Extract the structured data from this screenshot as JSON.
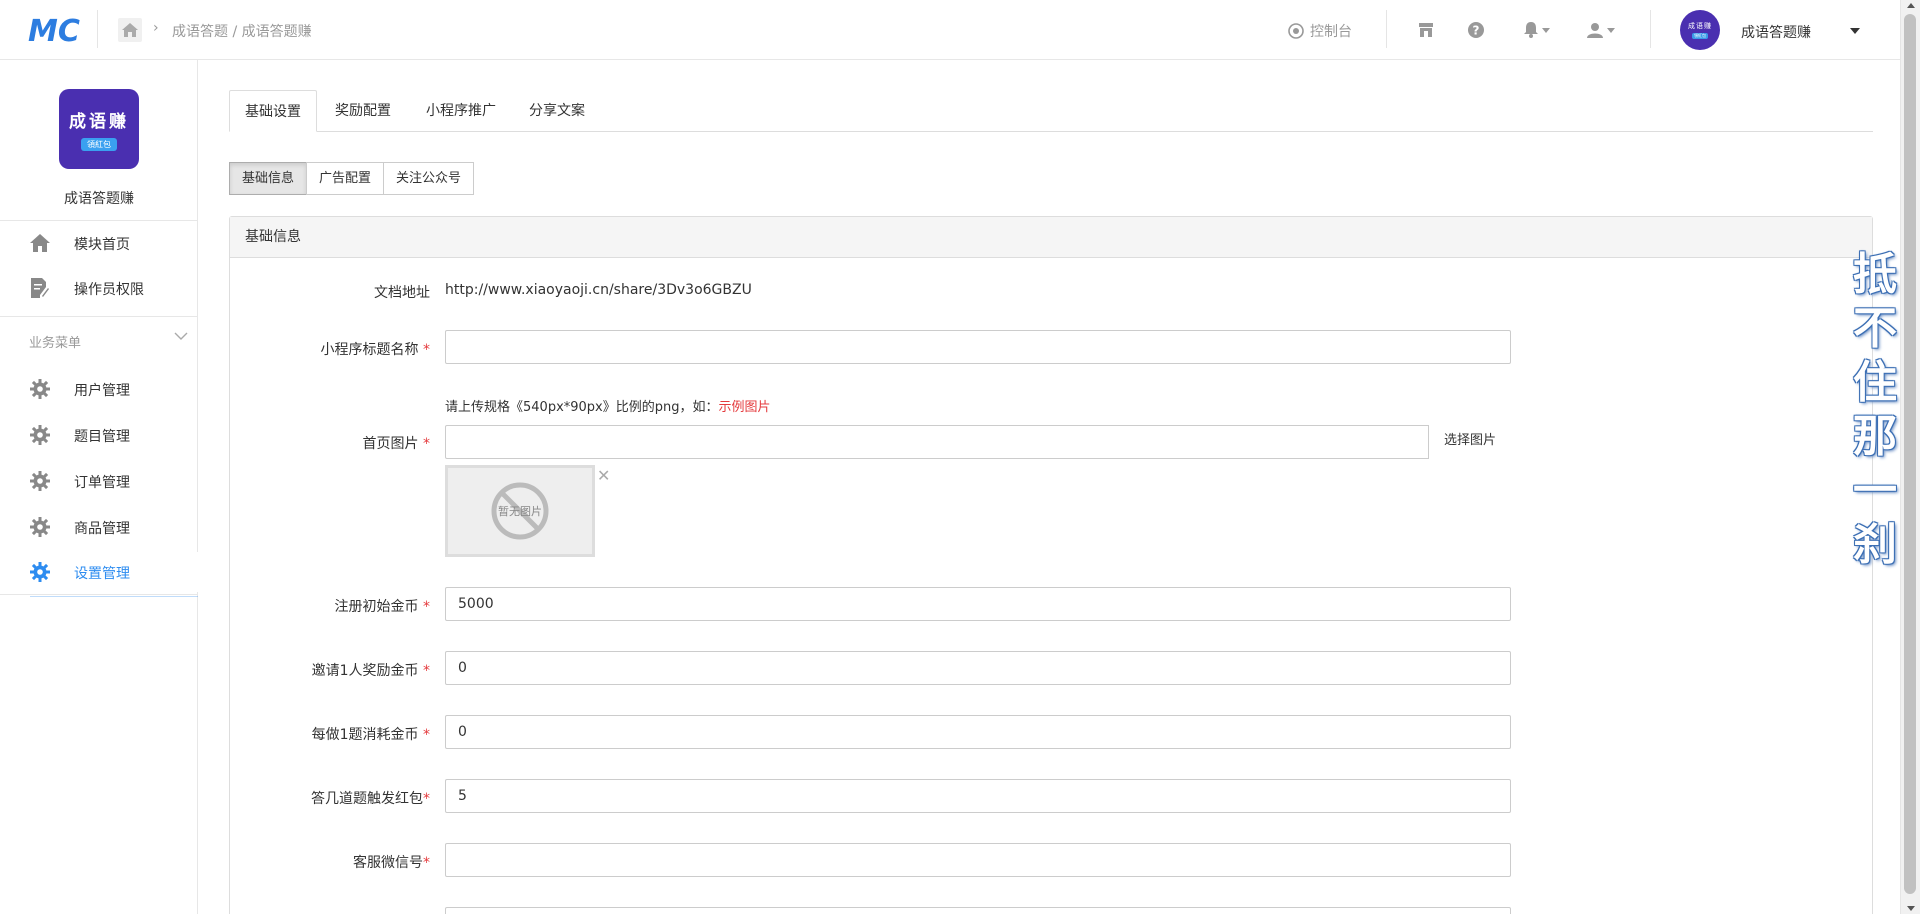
{
  "topbar": {
    "logo_text": "MC",
    "breadcrumb": "成语答题 / 成语答题赚",
    "console_label": "控制台",
    "user_name": "成语答题赚"
  },
  "sidebar": {
    "app_logo_title": "成语赚",
    "app_logo_badge": "領紅包",
    "app_name": "成语答题赚",
    "items_top": [
      {
        "label": "模块首页"
      },
      {
        "label": "操作员权限"
      }
    ],
    "section_title": "业务菜单",
    "items": [
      {
        "label": "用户管理"
      },
      {
        "label": "题目管理"
      },
      {
        "label": "订单管理"
      },
      {
        "label": "商品管理"
      },
      {
        "label": "设置管理"
      }
    ]
  },
  "tabs": [
    "基础设置",
    "奖励配置",
    "小程序推广",
    "分享文案"
  ],
  "subtabs": [
    "基础信息",
    "广告配置",
    "关注公众号"
  ],
  "panel": {
    "title": "基础信息",
    "doc_label": "文档地址",
    "doc_url": "http://www.xiaoyaoji.cn/share/3Dv3o6GBZU",
    "fields": {
      "mini_title_label": "小程序标题名称",
      "home_image_label": "首页图片",
      "home_image_hint": "请上传规格《540px*90px》比例的png，如：",
      "home_image_example": "示例图片",
      "pick_image": "选择图片",
      "no_image": "暂无图片",
      "register_coins_label": "注册初始金币",
      "register_coins_value": "5000",
      "invite_reward_label": "邀请1人奖励金币",
      "invite_reward_value": "0",
      "cost_per_question_label": "每做1题消耗金币",
      "cost_per_question_value": "0",
      "redpack_trigger_label": "答几道题触发红包",
      "redpack_trigger_value": "5",
      "service_wechat_label": "客服微信号",
      "service_wechat_value": ""
    }
  },
  "watermark": [
    "抵",
    "不",
    "住",
    "那",
    "一",
    "刹"
  ],
  "colors": {
    "brand_purple": "#4a2fb0",
    "active_blue": "#2d8cf0",
    "required_red": "#e4393c"
  }
}
